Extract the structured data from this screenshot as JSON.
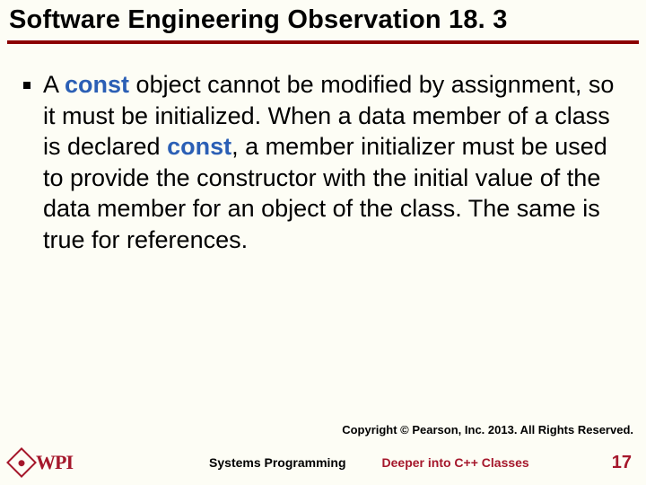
{
  "title": "Software Engineering Observation 18. 3",
  "body": {
    "pre1": "A ",
    "kw1": "const",
    "mid1": " object cannot be modified by assignment, so it must be initialized. When a data member of a class is declared ",
    "kw2": "const",
    "post1": ", a member initializer must be used to provide the constructor with the initial value of the data member for an object of the class. The same is true for references."
  },
  "copyright": "Copyright © Pearson, Inc. 2013. All Rights Reserved.",
  "footer": {
    "logo_text": "WPI",
    "left": "Systems Programming",
    "right": "Deeper into C++ Classes",
    "page": "17"
  }
}
